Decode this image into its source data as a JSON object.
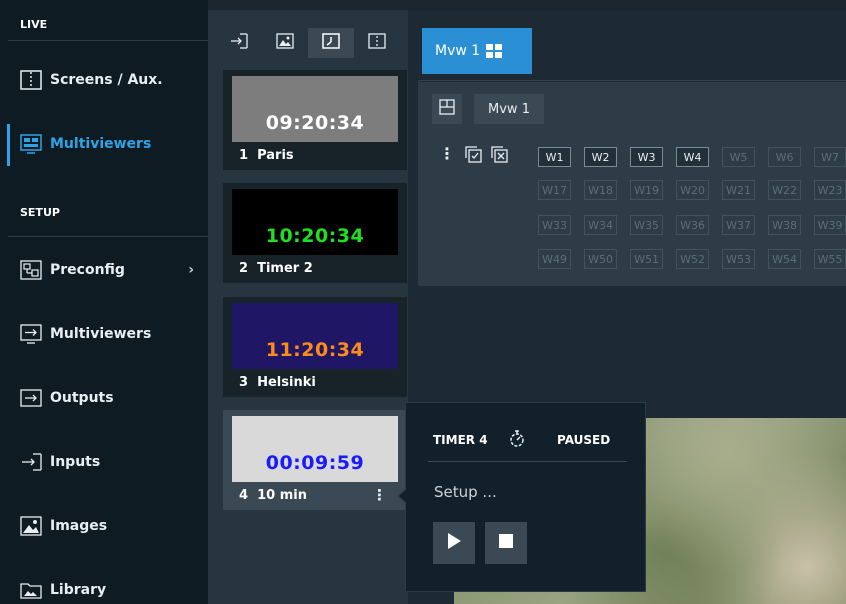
{
  "sidebar": {
    "live_header": "LIVE",
    "setup_header": "SETUP",
    "live_items": [
      {
        "label": "Screens / Aux.",
        "icon": "screens-aux-icon"
      },
      {
        "label": "Multiviewers",
        "icon": "multiviewer-icon",
        "active": true
      }
    ],
    "setup_items": [
      {
        "label": "Preconfig",
        "icon": "preconfig-icon",
        "has_submenu": true
      },
      {
        "label": "Multiviewers",
        "icon": "multiviewer-setup-icon"
      },
      {
        "label": "Outputs",
        "icon": "outputs-icon"
      },
      {
        "label": "Inputs",
        "icon": "inputs-icon"
      },
      {
        "label": "Images",
        "icon": "images-icon"
      },
      {
        "label": "Library",
        "icon": "library-icon"
      }
    ]
  },
  "source_tabs": [
    "input-tab-icon",
    "image-tab-icon",
    "timer-tab-icon",
    "aux-tab-icon"
  ],
  "timers": [
    {
      "time": "09:20:34",
      "number": "1",
      "name": "Paris",
      "bg": "#7d7d7d",
      "fg": "#ffffff"
    },
    {
      "time": "10:20:34",
      "number": "2",
      "name": "Timer 2",
      "bg": "#000000",
      "fg": "#1fe01f"
    },
    {
      "time": "11:20:34",
      "number": "3",
      "name": "Helsinki",
      "bg": "#1f1666",
      "fg": "#ff8c1a"
    },
    {
      "time": "00:09:59",
      "number": "4",
      "name": "10 min",
      "bg": "#d9d9d9",
      "fg": "#1a1aff"
    }
  ],
  "main": {
    "mvw_tab_label": "Mvw 1",
    "mvw_chip_label": "Mvw 1",
    "widgets": [
      [
        "W1",
        "W2",
        "W3",
        "W4",
        "W5",
        "W6",
        "W7"
      ],
      [
        "W17",
        "W18",
        "W19",
        "W20",
        "W21",
        "W22",
        "W23"
      ],
      [
        "W33",
        "W34",
        "W35",
        "W36",
        "W37",
        "W38",
        "W39"
      ],
      [
        "W49",
        "W50",
        "W51",
        "W52",
        "W53",
        "W54",
        "W55"
      ]
    ],
    "active_widgets": [
      "W1",
      "W2",
      "W3",
      "W4"
    ]
  },
  "popup": {
    "title": "TIMER 4",
    "status": "PAUSED",
    "setup_label": "Setup ..."
  },
  "colors": {
    "accent": "#2b8fd6",
    "active_nav": "#2fa3e8"
  }
}
